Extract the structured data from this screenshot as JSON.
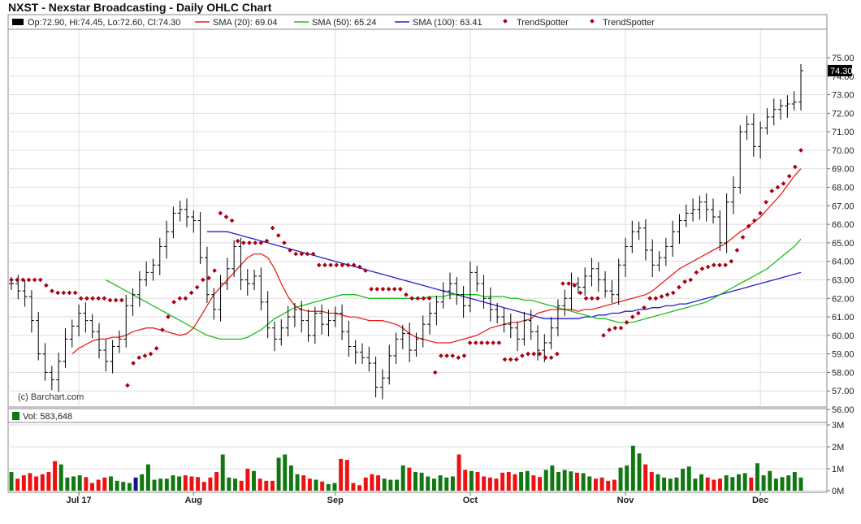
{
  "title": "NXST - Nexstar Broadcasting - Daily OHLC Chart",
  "copyright": "(c) Barchart.com",
  "legend": {
    "ohlc": "Op:72.90, Hi:74.45, Lo:72.60, Cl:74.30",
    "sma20": "SMA (20): 69.04",
    "sma50": "SMA (50): 65.24",
    "sma100": "SMA (100): 63.41",
    "trend1": "TrendSpotter",
    "trend2": "TrendSpotter"
  },
  "volume_label": "Vol: 583,648",
  "last_price_label": "74.30",
  "colors": {
    "sma20": "#e8201a",
    "sma50": "#22bb22",
    "sma100": "#2222cc",
    "trend": "#aa0011",
    "vol_up": "#117711",
    "vol_down": "#ee1111",
    "vol_flat": "#0a1a88"
  },
  "chart_data": {
    "type": "ohlc",
    "price_axis": {
      "min": 56,
      "max": 75,
      "ticks": [
        "56.00",
        "57.00",
        "58.00",
        "59.00",
        "60.00",
        "61.00",
        "62.00",
        "63.00",
        "64.00",
        "65.00",
        "66.00",
        "67.00",
        "68.00",
        "69.00",
        "70.00",
        "71.00",
        "72.00",
        "73.00",
        "74.00",
        "75.00"
      ]
    },
    "volume_axis": {
      "min": 0,
      "max": 3,
      "unit": "M",
      "ticks": [
        "0M",
        "1M",
        "2M",
        "3M"
      ]
    },
    "x_labels": [
      {
        "label": "Jul 17",
        "index": 10
      },
      {
        "label": "Aug",
        "index": 27
      },
      {
        "label": "Sep",
        "index": 48
      },
      {
        "label": "Oct",
        "index": 68
      },
      {
        "label": "Nov",
        "index": 91
      },
      {
        "label": "Dec",
        "index": 111
      }
    ],
    "close": [
      62.8,
      62.4,
      62.1,
      60.8,
      59.0,
      58.0,
      57.6,
      58.6,
      59.8,
      60.5,
      61.2,
      60.8,
      60.2,
      59.2,
      58.6,
      59.4,
      59.8,
      61.6,
      62.2,
      63.0,
      63.4,
      63.8,
      64.8,
      65.6,
      66.6,
      66.8,
      66.4,
      66.2,
      64.2,
      62.2,
      61.4,
      62.8,
      63.6,
      64.8,
      63.0,
      62.8,
      63.2,
      61.8,
      60.4,
      59.8,
      60.4,
      61.0,
      61.4,
      60.8,
      60.0,
      61.2,
      60.6,
      60.8,
      61.2,
      60.2,
      59.4,
      59.1,
      58.8,
      58.5,
      57.2,
      57.7,
      58.9,
      59.8,
      60.1,
      59.2,
      59.8,
      60.6,
      61.2,
      61.8,
      62.4,
      62.8,
      62.2,
      61.6,
      63.4,
      62.8,
      62.0,
      61.4,
      61.0,
      60.6,
      60.4,
      59.8,
      60.8,
      60.2,
      59.2,
      59.6,
      60.4,
      61.6,
      62.0,
      62.8,
      62.6,
      63.2,
      63.6,
      63.0,
      62.4,
      62.2,
      63.8,
      64.8,
      65.6,
      65.8,
      64.6,
      63.8,
      64.2,
      64.8,
      65.6,
      66.2,
      66.6,
      66.8,
      67.2,
      66.8,
      66.4,
      65.0,
      67.2,
      68.0,
      71.0,
      71.4,
      70.2,
      71.2,
      71.8,
      72.2,
      72.4,
      72.5,
      72.6,
      74.3
    ],
    "sma20": [
      59.0,
      59.3,
      59.5,
      59.7,
      59.8,
      59.8,
      59.9,
      59.9,
      60.0,
      60.2,
      60.3,
      60.4,
      60.4,
      60.3,
      60.2,
      60.1,
      60.0,
      60.1,
      60.4,
      61.0,
      61.6,
      62.2,
      62.6,
      63.0,
      63.4,
      63.8,
      64.2,
      64.4,
      64.4,
      64.2,
      63.6,
      62.8,
      62.1,
      61.6,
      61.4,
      61.3,
      61.3,
      61.3,
      61.2,
      61.2,
      61.1,
      61.0,
      61.0,
      60.9,
      60.8,
      60.8,
      60.8,
      60.7,
      60.6,
      60.4,
      60.1,
      59.9,
      59.8,
      59.7,
      59.6,
      59.6,
      59.6,
      59.7,
      59.8,
      59.9,
      60.0,
      60.2,
      60.4,
      60.5,
      60.6,
      60.7,
      60.7,
      60.8,
      60.9,
      61.2,
      61.3,
      61.4,
      61.4,
      61.4,
      61.4,
      61.3,
      61.4,
      61.4,
      61.5,
      61.6,
      61.7,
      61.8,
      61.9,
      62.0,
      62.1,
      62.2,
      62.4,
      62.7,
      63.0,
      63.3,
      63.6,
      63.8,
      64.0,
      64.2,
      64.4,
      64.6,
      64.8,
      65.0,
      65.3,
      65.6,
      65.8,
      66.1,
      66.4,
      66.8,
      67.2,
      67.6,
      68.1,
      68.6,
      69.0
    ],
    "sma50": [
      63.0,
      62.8,
      62.6,
      62.4,
      62.2,
      62.0,
      61.8,
      61.6,
      61.4,
      61.2,
      61.0,
      60.8,
      60.6,
      60.4,
      60.2,
      60.0,
      59.9,
      59.8,
      59.8,
      59.8,
      59.8,
      59.9,
      60.1,
      60.3,
      60.6,
      60.9,
      61.1,
      61.3,
      61.5,
      61.6,
      61.7,
      61.8,
      61.9,
      62.0,
      62.1,
      62.2,
      62.2,
      62.2,
      62.1,
      62.0,
      62.0,
      62.0,
      62.0,
      62.0,
      62.0,
      62.0,
      62.0,
      62.0,
      62.1,
      62.1,
      62.1,
      62.2,
      62.2,
      62.2,
      62.2,
      62.2,
      62.1,
      62.1,
      62.1,
      62.1,
      62.0,
      62.0,
      61.9,
      61.9,
      61.8,
      61.7,
      61.6,
      61.5,
      61.4,
      61.3,
      61.2,
      61.1,
      61.0,
      60.9,
      60.9,
      60.8,
      60.7,
      60.7,
      60.7,
      60.8,
      60.9,
      61.0,
      61.1,
      61.2,
      61.3,
      61.4,
      61.5,
      61.6,
      61.7,
      61.8,
      62.0,
      62.2,
      62.4,
      62.6,
      62.8,
      63.0,
      63.2,
      63.4,
      63.6,
      63.9,
      64.2,
      64.5,
      64.8,
      65.2
    ],
    "sma100": [
      65.6,
      65.6,
      65.6,
      65.6,
      65.5,
      65.4,
      65.3,
      65.2,
      65.1,
      65.0,
      64.9,
      64.8,
      64.7,
      64.6,
      64.5,
      64.4,
      64.3,
      64.2,
      64.1,
      64.0,
      63.9,
      63.8,
      63.7,
      63.6,
      63.5,
      63.4,
      63.3,
      63.2,
      63.1,
      63.0,
      62.9,
      62.8,
      62.7,
      62.6,
      62.5,
      62.4,
      62.3,
      62.2,
      62.1,
      62.0,
      61.9,
      61.8,
      61.7,
      61.6,
      61.5,
      61.4,
      61.3,
      61.2,
      61.1,
      61.0,
      60.9,
      60.9,
      60.9,
      60.9,
      60.9,
      60.9,
      61.0,
      61.0,
      61.1,
      61.1,
      61.2,
      61.2,
      61.3,
      61.3,
      61.4,
      61.4,
      61.5,
      61.5,
      61.6,
      61.6,
      61.7,
      61.7,
      61.8,
      61.9,
      62.0,
      62.1,
      62.2,
      62.3,
      62.4,
      62.5,
      62.6,
      62.7,
      62.8,
      62.9,
      63.0,
      63.1,
      63.2,
      63.3,
      63.4
    ],
    "trendspotter": [
      63.0,
      63.0,
      63.0,
      63.0,
      63.0,
      63.0,
      62.7,
      62.4,
      62.3,
      62.3,
      62.3,
      62.3,
      62.0,
      62.0,
      62.0,
      62.0,
      62.0,
      61.9,
      61.9,
      61.9,
      57.3,
      58.5,
      58.8,
      58.9,
      59.0,
      59.3,
      60.3,
      61.0,
      61.8,
      62.0,
      62.0,
      62.3,
      62.6,
      63.0,
      63.1,
      63.5,
      66.6,
      66.4,
      66.2,
      65.1,
      65.0,
      65.0,
      65.0,
      65.0,
      65.1,
      65.8,
      65.4,
      65.0,
      64.6,
      64.4,
      64.4,
      64.4,
      64.4,
      63.8,
      63.8,
      63.8,
      63.8,
      63.8,
      63.8,
      63.8,
      63.7,
      63.5,
      62.5,
      62.5,
      62.5,
      62.5,
      62.5,
      62.5,
      62.2,
      62.0,
      62.0,
      62.0,
      62.0,
      58.0,
      58.9,
      58.9,
      58.9,
      58.8,
      58.9,
      59.6,
      59.6,
      59.6,
      59.6,
      59.6,
      59.6,
      58.7,
      58.7,
      58.7,
      58.9,
      59.0,
      59.0,
      59.0,
      58.8,
      58.8,
      59.0,
      62.8,
      62.8,
      62.7,
      62.3,
      62.0,
      62.0,
      62.0,
      60.0,
      60.3,
      60.4,
      60.4,
      60.7,
      61.0,
      61.2,
      61.5,
      62.0,
      62.0,
      62.1,
      62.2,
      62.3,
      62.6,
      62.9,
      63.0,
      63.4,
      63.6,
      63.7,
      63.8,
      63.8,
      63.8,
      64.0,
      64.6,
      65.3,
      65.9,
      66.2,
      66.6,
      67.2,
      67.8,
      68.0,
      68.2,
      68.6,
      69.1,
      70.0
    ],
    "volume": [
      0.85,
      0.55,
      0.7,
      0.8,
      0.65,
      0.75,
      0.85,
      1.35,
      1.2,
      0.6,
      0.65,
      0.7,
      0.62,
      0.35,
      0.5,
      0.6,
      0.65,
      0.45,
      0.4,
      0.35,
      0.6,
      0.75,
      1.2,
      0.5,
      0.55,
      0.55,
      0.7,
      0.65,
      0.7,
      0.65,
      0.62,
      0.4,
      0.6,
      0.85,
      1.65,
      0.6,
      0.55,
      0.45,
      1.0,
      0.9,
      0.55,
      0.45,
      0.45,
      1.5,
      1.65,
      1.15,
      0.75,
      0.7,
      0.55,
      0.5,
      0.42,
      0.3,
      0.35,
      1.45,
      1.4,
      0.35,
      0.25,
      0.6,
      0.75,
      0.7,
      0.55,
      0.5,
      0.5,
      1.15,
      1.05,
      0.85,
      0.82,
      0.65,
      0.55,
      0.7,
      0.6,
      0.65,
      1.65,
      0.95,
      0.9,
      0.85,
      0.65,
      0.6,
      0.55,
      0.82,
      0.85,
      0.75,
      0.85,
      0.9,
      0.7,
      0.62,
      0.95,
      1.15,
      0.85,
      0.95,
      0.88,
      0.82,
      0.8,
      0.65,
      0.55,
      0.6,
      0.45,
      0.5,
      1.05,
      1.15,
      2.05,
      1.7,
      1.2,
      0.85,
      0.75,
      0.6,
      0.55,
      0.6,
      1.0,
      1.1,
      0.55,
      0.75,
      0.6,
      0.5,
      0.55,
      0.7,
      0.62,
      0.75,
      0.8,
      0.6,
      1.25,
      0.7,
      0.9,
      0.55,
      0.62,
      0.7,
      0.85,
      0.6
    ]
  }
}
